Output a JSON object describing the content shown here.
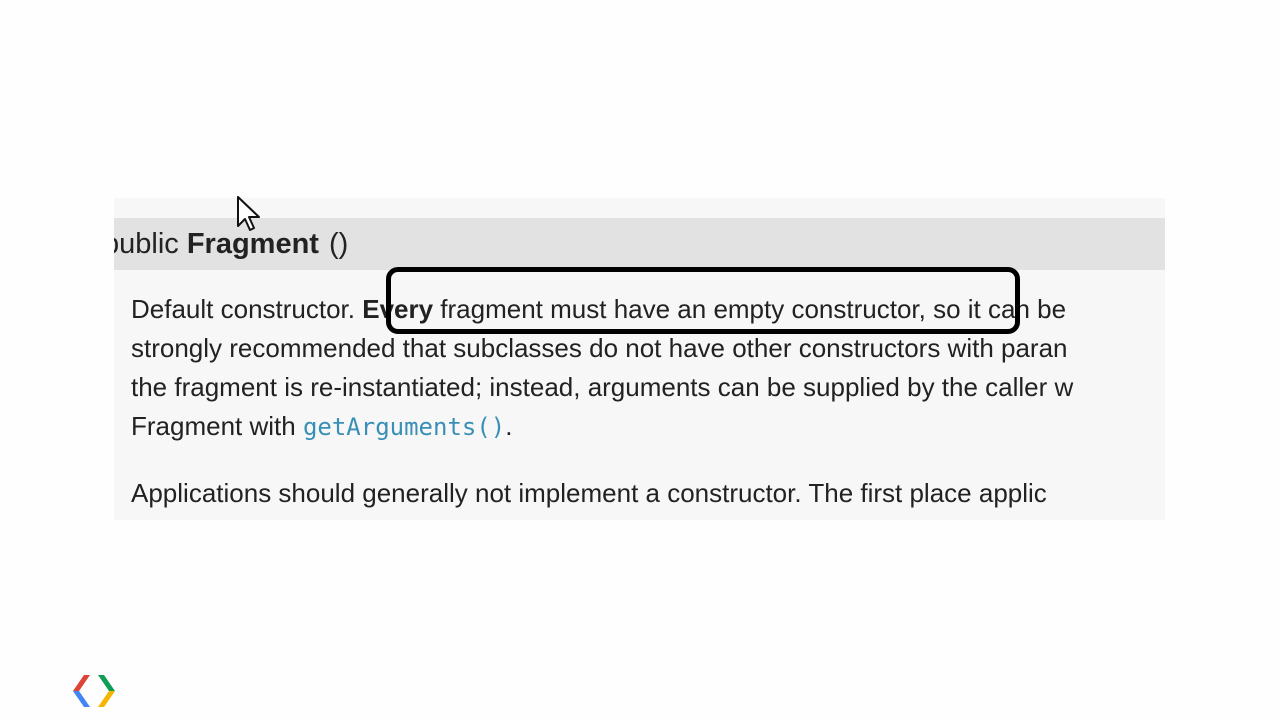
{
  "signature": {
    "prefix": "public ",
    "method_name": "Fragment",
    "parens": "()"
  },
  "paragraph1": {
    "line1_pre": "Default constructor. ",
    "line1_bold": "Every",
    "line1_post": " fragment must have an empty constructor, so it can be",
    "line2": "strongly recommended that subclasses do not have other constructors with paran",
    "line3": "the fragment is re-instantiated; instead, arguments can be supplied by the caller w",
    "line4_pre": "Fragment with ",
    "line4_code": "getArguments()",
    "line4_post": "."
  },
  "paragraph2": {
    "line1": "Applications should generally not implement a constructor. The first place applic"
  },
  "icons": {
    "cursor": "mouse-pointer-icon",
    "logo": "google-developers-logo"
  },
  "colors": {
    "link": "#3a8fb7",
    "highlight_border": "#000000",
    "signature_bar": "#e2e2e2",
    "logo_red": "#db4437",
    "logo_blue": "#4285f4",
    "logo_green": "#0f9d58",
    "logo_yellow": "#f4b400"
  }
}
